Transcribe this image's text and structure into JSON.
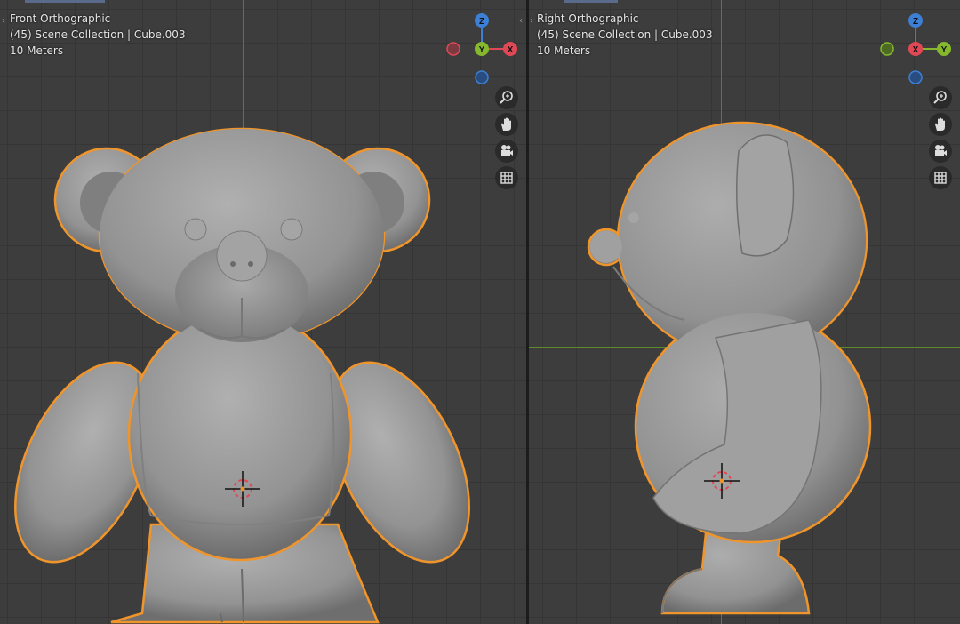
{
  "views": {
    "left": {
      "title": "Front Orthographic",
      "collection": "(45) Scene Collection | Cube.003",
      "scale": "10 Meters",
      "gizmo": {
        "up": "Z",
        "center": "Y",
        "right": "X"
      }
    },
    "right": {
      "title": "Right Orthographic",
      "collection": "(45) Scene Collection | Cube.003",
      "scale": "10 Meters",
      "gizmo": {
        "up": "Z",
        "center": "X",
        "right": "Y"
      }
    }
  },
  "colors": {
    "axis_x": "#e04856",
    "axis_y": "#86b82e",
    "axis_z": "#3d7fd4",
    "selection_outline": "#f0952b",
    "model_gray": "#9c9c9c"
  },
  "nav_tools": [
    "zoom-icon",
    "pan-hand-icon",
    "camera-icon",
    "grid-icon"
  ]
}
